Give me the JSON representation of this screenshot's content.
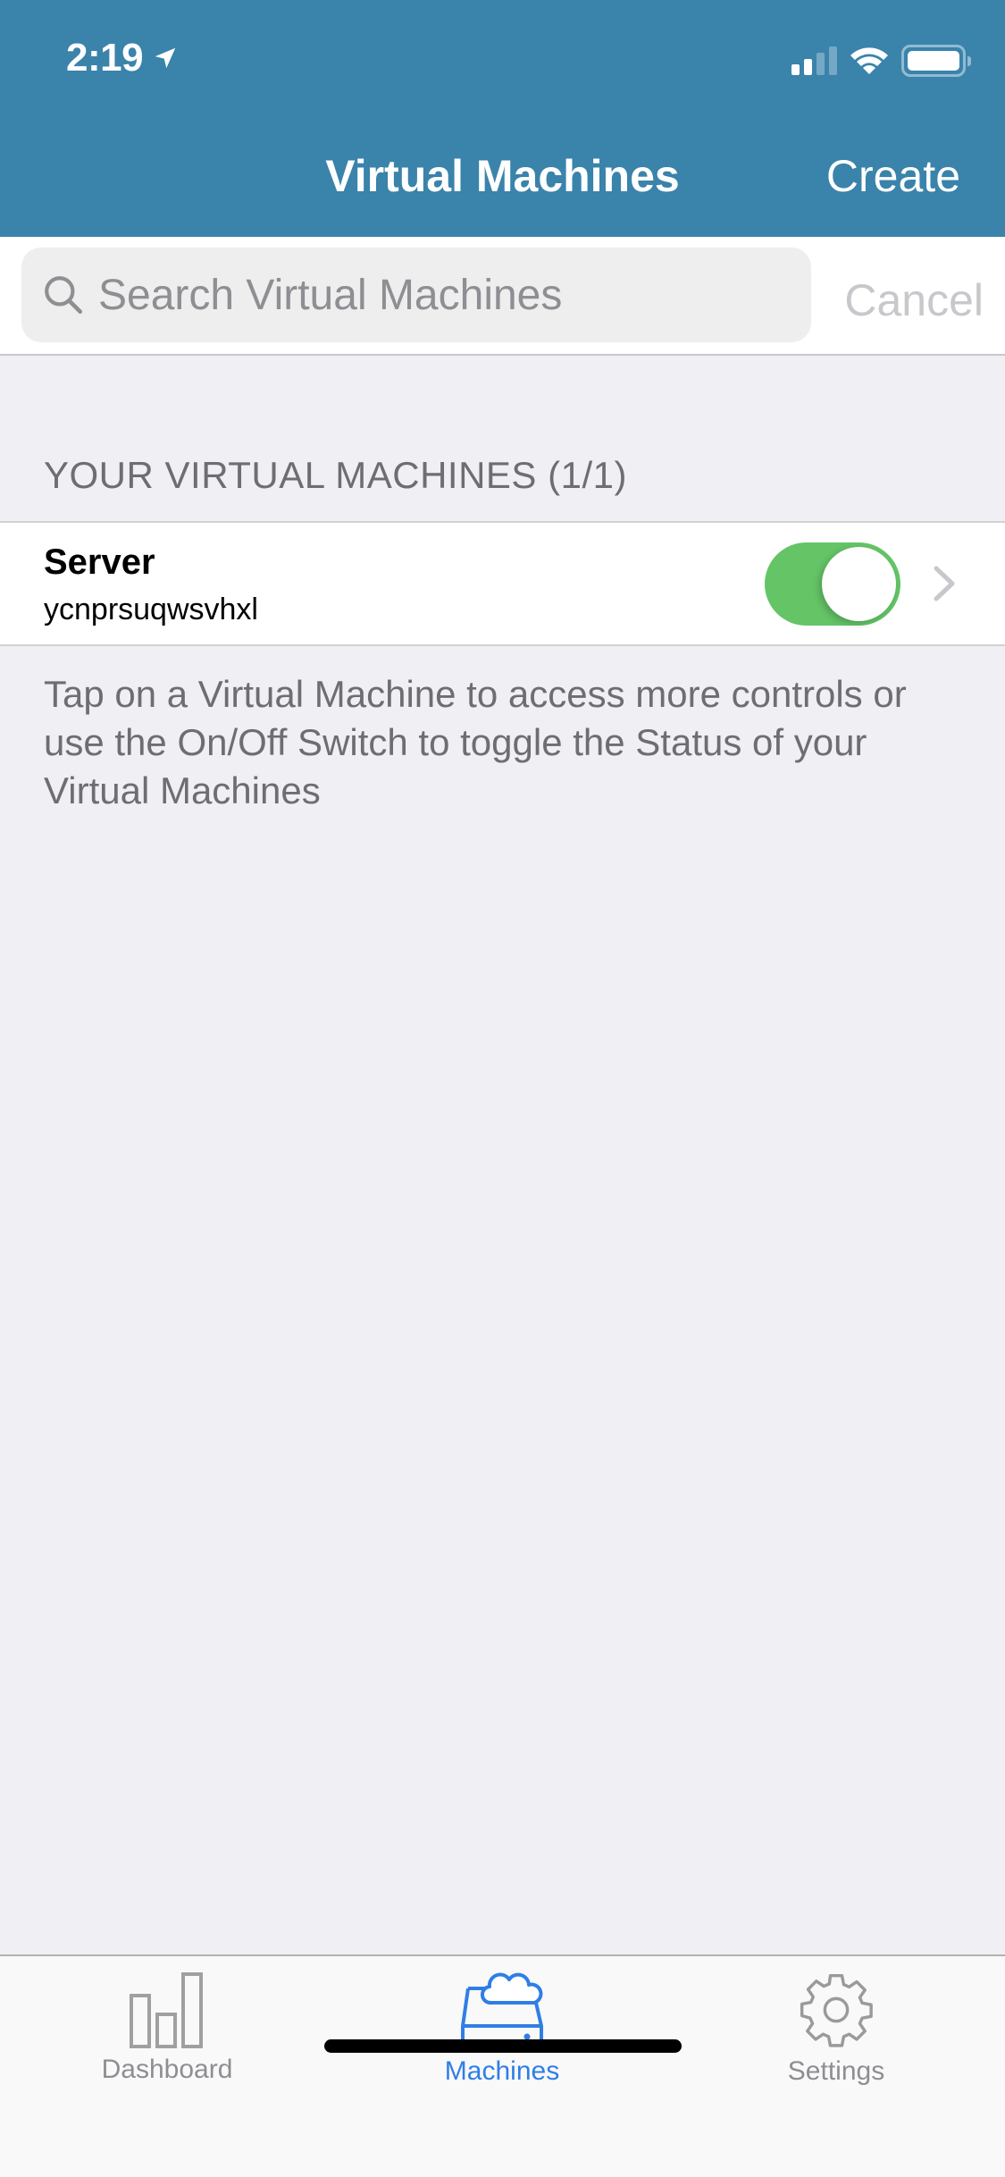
{
  "status_bar": {
    "time": "2:19",
    "location_icon": "location-arrow-icon",
    "signal_bars_on": 2,
    "signal_bars_total": 4,
    "wifi_icon": "wifi-icon",
    "battery_icon": "battery-icon"
  },
  "nav": {
    "title": "Virtual Machines",
    "create_label": "Create"
  },
  "search": {
    "placeholder": "Search Virtual Machines",
    "value": "",
    "cancel_label": "Cancel"
  },
  "section": {
    "header": "YOUR VIRTUAL MACHINES (1/1)"
  },
  "machines": [
    {
      "name": "Server",
      "id": "ycnprsuqwsvhxl",
      "power_on": true
    }
  ],
  "help_text": "Tap on a Virtual Machine to access more controls or use the On/Off Switch to toggle the Status of your Virtual Machines",
  "tabbar": {
    "tabs": [
      {
        "label": "Dashboard",
        "icon": "bar-chart-icon",
        "active": false
      },
      {
        "label": "Machines",
        "icon": "cloud-server-icon",
        "active": true
      },
      {
        "label": "Settings",
        "icon": "gear-icon",
        "active": false
      }
    ]
  },
  "colors": {
    "header_bg": "#3a83ab",
    "toggle_on": "#64c466",
    "tab_active": "#2f7ee6",
    "tab_inactive": "#8e8e93",
    "page_bg": "#efeff4"
  }
}
